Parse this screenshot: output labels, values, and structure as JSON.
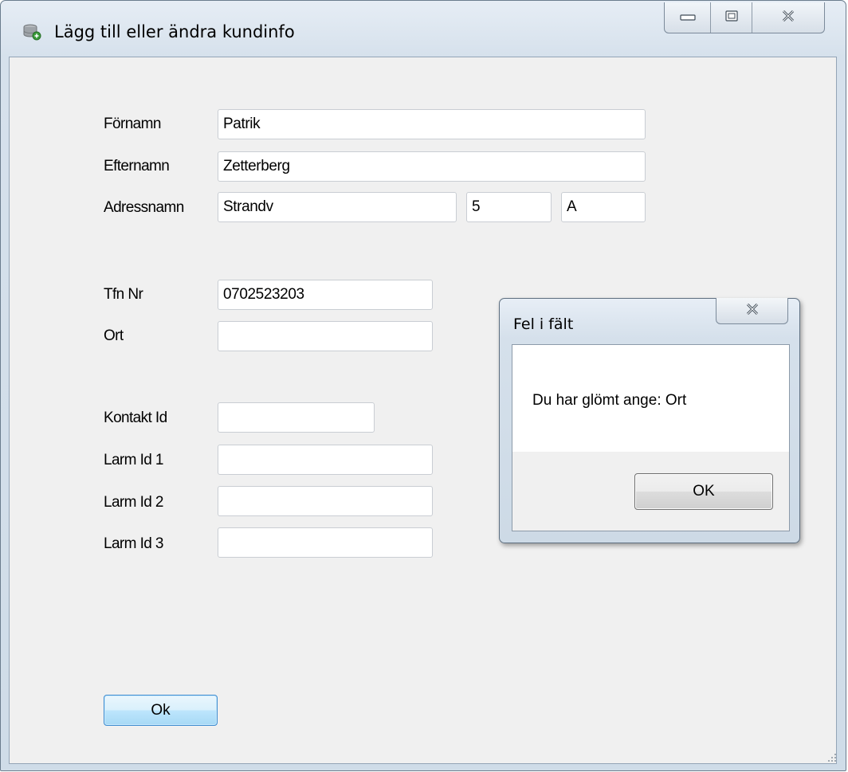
{
  "window": {
    "title": "Lägg till eller ändra kundinfo",
    "icon": "database-icon"
  },
  "form": {
    "labels": {
      "fornamn": "Förnamn",
      "efternamn": "Efternamn",
      "adressnamn": "Adressnamn",
      "tfn_nr": "Tfn Nr",
      "ort": "Ort",
      "kontakt_id": "Kontakt Id",
      "larm_id_1": "Larm Id 1",
      "larm_id_2": "Larm Id 2",
      "larm_id_3": "Larm Id 3"
    },
    "values": {
      "fornamn": "Patrik",
      "efternamn": "Zetterberg",
      "adress_street": "Strandv",
      "adress_number": "5",
      "adress_letter": "A",
      "tfn_nr": "0702523203",
      "ort": "",
      "kontakt_id": "",
      "larm_id_1": "",
      "larm_id_2": "",
      "larm_id_3": ""
    },
    "ok_label": "Ok"
  },
  "dialog": {
    "title": "Fel i fält",
    "message": "Du har glömt ange: Ort",
    "ok_label": "OK"
  },
  "colors": {
    "ok_button_border": "#3c8bd0",
    "client_bg": "#f0f0f0"
  }
}
